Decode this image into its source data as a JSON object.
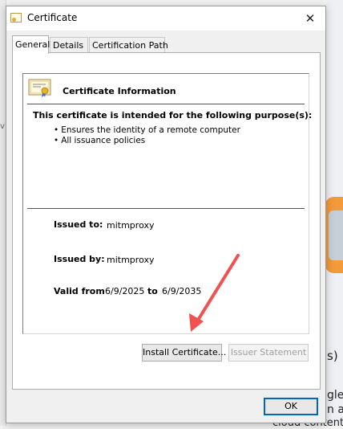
{
  "background": {
    "left_mark": "v",
    "right_texts": [
      "s)",
      "gle",
      "n ar",
      "cloud content"
    ]
  },
  "window": {
    "title": "Certificate",
    "close_glyph": "✕"
  },
  "tabs": [
    {
      "label": "General",
      "active": true
    },
    {
      "label": "Details",
      "active": false
    },
    {
      "label": "Certification Path",
      "active": false
    }
  ],
  "certificate": {
    "heading": "Certificate Information",
    "purpose_title": "This certificate is intended for the following purpose(s):",
    "purposes": [
      "Ensures the identity of a remote computer",
      "All issuance policies"
    ],
    "issued_to_label": "Issued to:",
    "issued_to": "mitmproxy",
    "issued_by_label": "Issued by:",
    "issued_by": "mitmproxy",
    "valid_from_label": "Valid from",
    "valid_from": "6/9/2025",
    "valid_to_label": "to",
    "valid_to": "6/9/2035"
  },
  "buttons": {
    "install": "Install Certificate...",
    "issuer": "Issuer Statement",
    "ok": "OK"
  },
  "colors": {
    "accent": "#0067c0",
    "annotation_arrow": "#f0524f",
    "background_orange": "#f39a3b"
  },
  "icons": {
    "title": "certificate-icon",
    "info": "certificate-ribbon-icon",
    "close": "close-icon"
  }
}
